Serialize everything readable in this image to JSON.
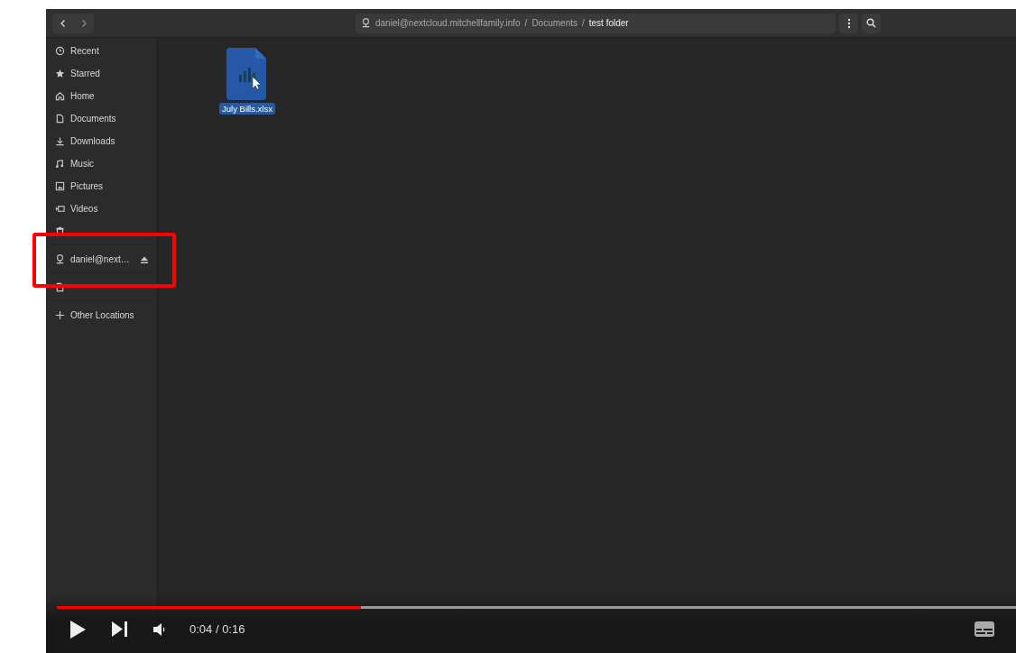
{
  "header": {
    "path": [
      {
        "label": "daniel@nextcloud.mitchellfamily.info",
        "kind": "remote",
        "selected": false
      },
      {
        "label": "Documents",
        "kind": "folder",
        "selected": false
      },
      {
        "label": "test folder",
        "kind": "folder",
        "selected": true
      }
    ],
    "separators": [
      "/",
      "/"
    ]
  },
  "sidebar": {
    "sections": [
      [
        {
          "label": "Recent",
          "kind": "recent",
          "ejectable": false
        },
        {
          "label": "Starred",
          "kind": "starred",
          "ejectable": false
        },
        {
          "label": "Home",
          "kind": "home",
          "ejectable": false
        },
        {
          "label": "Documents",
          "kind": "document",
          "ejectable": false
        },
        {
          "label": "Downloads",
          "kind": "download",
          "ejectable": false
        },
        {
          "label": "Music",
          "kind": "music",
          "ejectable": false
        },
        {
          "label": "Pictures",
          "kind": "pictures",
          "ejectable": false
        },
        {
          "label": "Videos",
          "kind": "videos",
          "ejectable": false
        },
        {
          "kind": "trash",
          "ejectable": false
        }
      ],
      [
        {
          "label": "daniel@next…",
          "kind": "remote",
          "ejectable": true
        }
      ],
      [
        {
          "kind": "document",
          "ejectable": false
        }
      ],
      [
        {
          "label": "Other Locations",
          "kind": "other",
          "ejectable": false
        }
      ]
    ]
  },
  "files": [
    {
      "name": "July Bills.xlsx",
      "kind": "spreadsheet",
      "selected": true
    }
  ],
  "player": {
    "progress": {
      "level": 0.317
    },
    "time": "0:04 / 0:16"
  }
}
